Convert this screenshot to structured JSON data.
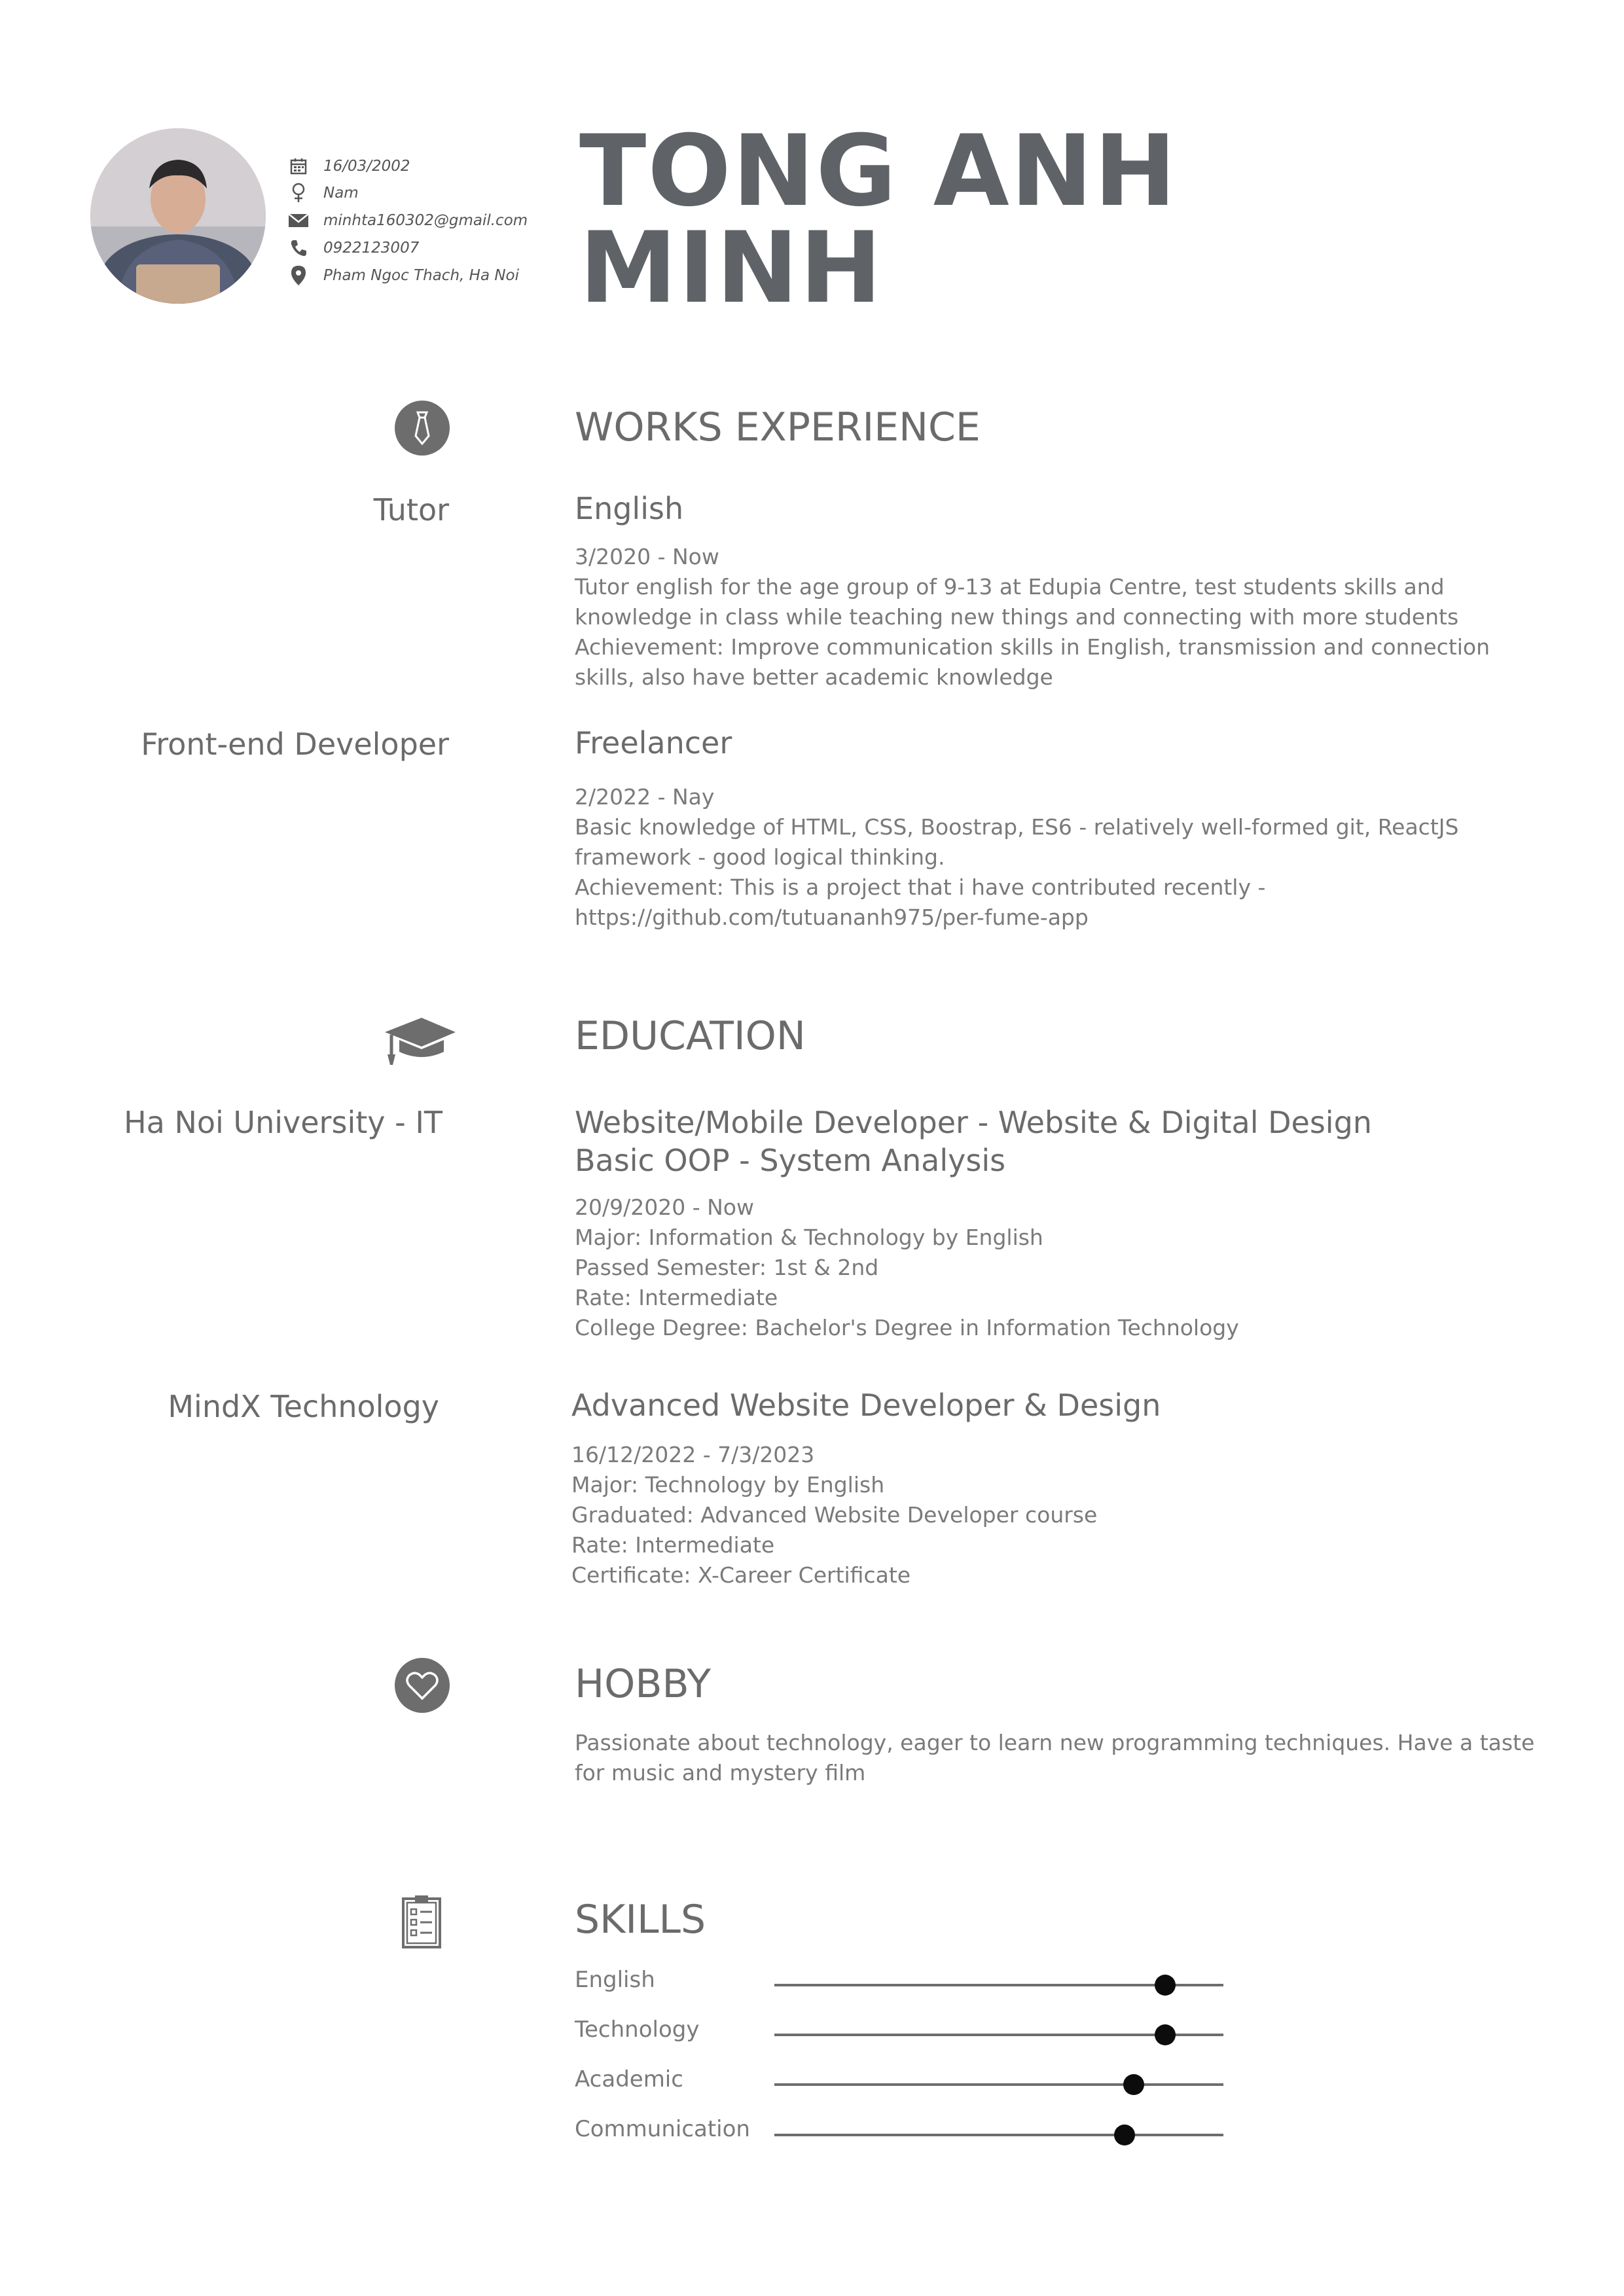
{
  "header": {
    "name_line1": "TONG ANH",
    "name_line2": "MINH",
    "contact": [
      {
        "icon": "calendar-icon",
        "text": "16/03/2002"
      },
      {
        "icon": "female-icon",
        "text": "Nam"
      },
      {
        "icon": "envelope-icon",
        "text": "minhta160302@gmail.com"
      },
      {
        "icon": "phone-icon",
        "text": "0922123007"
      },
      {
        "icon": "location-pin-icon",
        "text": "Pham Ngoc Thach, Ha Noi"
      }
    ]
  },
  "experience": {
    "title": "WORKS EXPERIENCE",
    "icon": "tie-icon",
    "entries": [
      {
        "role": "Tutor",
        "org": "English",
        "lines": [
          "3/2020 - Now",
          "Tutor english for the age group of 9-13 at Edupia Centre, test students skills and knowledge in class while teaching new things and connecting with more students",
          "Achievement: Improve communication skills in English, transmission and connection skills, also have better academic knowledge"
        ]
      },
      {
        "role": "Front-end Developer",
        "org": "Freelancer",
        "lines": [
          "2/2022 - Nay",
          "Basic knowledge of HTML, CSS, Boostrap, ES6 - relatively well-formed git, ReactJS framework - good logical thinking.",
          "Achievement: This is a project that i have contributed recently - https://github.com/tutuananh975/per-fume-app"
        ]
      }
    ]
  },
  "education": {
    "title": "EDUCATION",
    "icon": "graduation-cap-icon",
    "entries": [
      {
        "school": "Ha Noi University - IT",
        "titles": [
          "Website/Mobile Developer - Website & Digital Design",
          "Basic OOP - System Analysis"
        ],
        "lines": [
          "20/9/2020 - Now",
          "Major: Information & Technology by English",
          "Passed Semester: 1st & 2nd",
          "Rate: Intermediate",
          "College Degree: Bachelor's Degree in Information Technology"
        ]
      },
      {
        "school": "MindX Technology",
        "titles": [
          "Advanced Website Developer & Design"
        ],
        "lines": [
          "16/12/2022 - 7/3/2023",
          "Major: Technology by English",
          "Graduated: Advanced Website Developer course",
          "Rate: Intermediate",
          "Certificate: X-Career Certificate"
        ]
      }
    ]
  },
  "hobby": {
    "title": "HOBBY",
    "icon": "heart-icon",
    "text": "Passionate about technology, eager to learn new programming techniques. Have a taste for music and mystery film"
  },
  "skills": {
    "title": "SKILLS",
    "icon": "clipboard-icon",
    "items": [
      {
        "label": "English",
        "level": 0.87
      },
      {
        "label": "Technology",
        "level": 0.87
      },
      {
        "label": "Academic",
        "level": 0.8
      },
      {
        "label": "Communication",
        "level": 0.78
      }
    ]
  }
}
